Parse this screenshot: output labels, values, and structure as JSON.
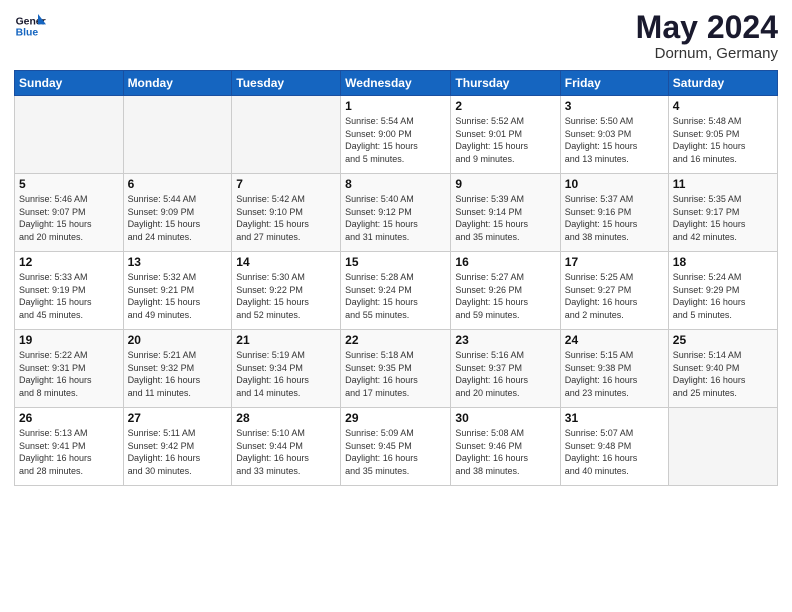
{
  "header": {
    "logo_line1": "General",
    "logo_line2": "Blue",
    "month": "May 2024",
    "location": "Dornum, Germany"
  },
  "weekdays": [
    "Sunday",
    "Monday",
    "Tuesday",
    "Wednesday",
    "Thursday",
    "Friday",
    "Saturday"
  ],
  "weeks": [
    [
      {
        "day": "",
        "info": ""
      },
      {
        "day": "",
        "info": ""
      },
      {
        "day": "",
        "info": ""
      },
      {
        "day": "1",
        "info": "Sunrise: 5:54 AM\nSunset: 9:00 PM\nDaylight: 15 hours\nand 5 minutes."
      },
      {
        "day": "2",
        "info": "Sunrise: 5:52 AM\nSunset: 9:01 PM\nDaylight: 15 hours\nand 9 minutes."
      },
      {
        "day": "3",
        "info": "Sunrise: 5:50 AM\nSunset: 9:03 PM\nDaylight: 15 hours\nand 13 minutes."
      },
      {
        "day": "4",
        "info": "Sunrise: 5:48 AM\nSunset: 9:05 PM\nDaylight: 15 hours\nand 16 minutes."
      }
    ],
    [
      {
        "day": "5",
        "info": "Sunrise: 5:46 AM\nSunset: 9:07 PM\nDaylight: 15 hours\nand 20 minutes."
      },
      {
        "day": "6",
        "info": "Sunrise: 5:44 AM\nSunset: 9:09 PM\nDaylight: 15 hours\nand 24 minutes."
      },
      {
        "day": "7",
        "info": "Sunrise: 5:42 AM\nSunset: 9:10 PM\nDaylight: 15 hours\nand 27 minutes."
      },
      {
        "day": "8",
        "info": "Sunrise: 5:40 AM\nSunset: 9:12 PM\nDaylight: 15 hours\nand 31 minutes."
      },
      {
        "day": "9",
        "info": "Sunrise: 5:39 AM\nSunset: 9:14 PM\nDaylight: 15 hours\nand 35 minutes."
      },
      {
        "day": "10",
        "info": "Sunrise: 5:37 AM\nSunset: 9:16 PM\nDaylight: 15 hours\nand 38 minutes."
      },
      {
        "day": "11",
        "info": "Sunrise: 5:35 AM\nSunset: 9:17 PM\nDaylight: 15 hours\nand 42 minutes."
      }
    ],
    [
      {
        "day": "12",
        "info": "Sunrise: 5:33 AM\nSunset: 9:19 PM\nDaylight: 15 hours\nand 45 minutes."
      },
      {
        "day": "13",
        "info": "Sunrise: 5:32 AM\nSunset: 9:21 PM\nDaylight: 15 hours\nand 49 minutes."
      },
      {
        "day": "14",
        "info": "Sunrise: 5:30 AM\nSunset: 9:22 PM\nDaylight: 15 hours\nand 52 minutes."
      },
      {
        "day": "15",
        "info": "Sunrise: 5:28 AM\nSunset: 9:24 PM\nDaylight: 15 hours\nand 55 minutes."
      },
      {
        "day": "16",
        "info": "Sunrise: 5:27 AM\nSunset: 9:26 PM\nDaylight: 15 hours\nand 59 minutes."
      },
      {
        "day": "17",
        "info": "Sunrise: 5:25 AM\nSunset: 9:27 PM\nDaylight: 16 hours\nand 2 minutes."
      },
      {
        "day": "18",
        "info": "Sunrise: 5:24 AM\nSunset: 9:29 PM\nDaylight: 16 hours\nand 5 minutes."
      }
    ],
    [
      {
        "day": "19",
        "info": "Sunrise: 5:22 AM\nSunset: 9:31 PM\nDaylight: 16 hours\nand 8 minutes."
      },
      {
        "day": "20",
        "info": "Sunrise: 5:21 AM\nSunset: 9:32 PM\nDaylight: 16 hours\nand 11 minutes."
      },
      {
        "day": "21",
        "info": "Sunrise: 5:19 AM\nSunset: 9:34 PM\nDaylight: 16 hours\nand 14 minutes."
      },
      {
        "day": "22",
        "info": "Sunrise: 5:18 AM\nSunset: 9:35 PM\nDaylight: 16 hours\nand 17 minutes."
      },
      {
        "day": "23",
        "info": "Sunrise: 5:16 AM\nSunset: 9:37 PM\nDaylight: 16 hours\nand 20 minutes."
      },
      {
        "day": "24",
        "info": "Sunrise: 5:15 AM\nSunset: 9:38 PM\nDaylight: 16 hours\nand 23 minutes."
      },
      {
        "day": "25",
        "info": "Sunrise: 5:14 AM\nSunset: 9:40 PM\nDaylight: 16 hours\nand 25 minutes."
      }
    ],
    [
      {
        "day": "26",
        "info": "Sunrise: 5:13 AM\nSunset: 9:41 PM\nDaylight: 16 hours\nand 28 minutes."
      },
      {
        "day": "27",
        "info": "Sunrise: 5:11 AM\nSunset: 9:42 PM\nDaylight: 16 hours\nand 30 minutes."
      },
      {
        "day": "28",
        "info": "Sunrise: 5:10 AM\nSunset: 9:44 PM\nDaylight: 16 hours\nand 33 minutes."
      },
      {
        "day": "29",
        "info": "Sunrise: 5:09 AM\nSunset: 9:45 PM\nDaylight: 16 hours\nand 35 minutes."
      },
      {
        "day": "30",
        "info": "Sunrise: 5:08 AM\nSunset: 9:46 PM\nDaylight: 16 hours\nand 38 minutes."
      },
      {
        "day": "31",
        "info": "Sunrise: 5:07 AM\nSunset: 9:48 PM\nDaylight: 16 hours\nand 40 minutes."
      },
      {
        "day": "",
        "info": ""
      }
    ]
  ]
}
